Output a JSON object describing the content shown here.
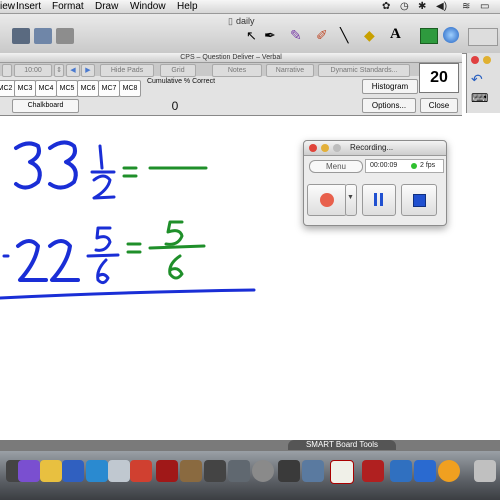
{
  "menubar": {
    "items": [
      "iew",
      "Insert",
      "Format",
      "Draw",
      "Window",
      "Help"
    ]
  },
  "toolbar": {
    "document_title": "daily"
  },
  "cps": {
    "title": "CPS – Question Deliver – Verbal",
    "timer": "10:00",
    "hide_pads": "Hide Pads",
    "grid": "Grid",
    "notes": "Notes",
    "narrative": "Narrative",
    "dynamic_standards": "Dynamic Standards...",
    "mc_buttons": [
      "MC2",
      "MC3",
      "MC4",
      "MC5",
      "MC6",
      "MC7",
      "MC8"
    ],
    "chalkboard": "Chalkboard",
    "cumulative_label": "Cumulative % Correct",
    "cumulative_value": "0",
    "histogram": "Histogram",
    "options": "Options...",
    "close": "Close",
    "count": "20"
  },
  "recording": {
    "title": "Recording...",
    "menu": "Menu",
    "time": "00:00:09",
    "fps": "2 fps"
  },
  "bottom": {
    "smart_board_tools": "SMART Board Tools"
  },
  "colors": {
    "blue_ink": "#1a2ed6",
    "green_ink": "#1f8f2a",
    "rec_red": "#e8604c",
    "rec_blue": "#2050d0"
  }
}
